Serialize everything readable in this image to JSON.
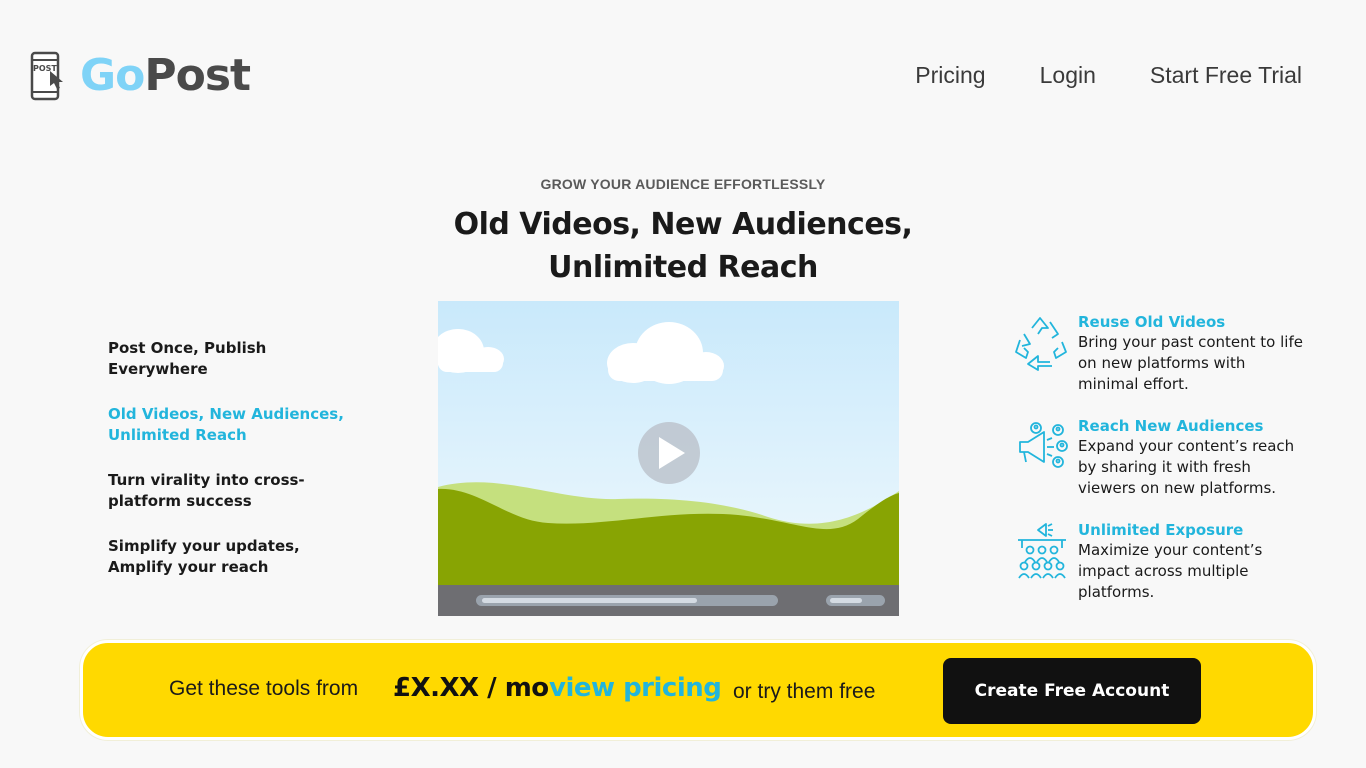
{
  "header": {
    "logo": {
      "go": "Go",
      "post": "Post",
      "icon_text": "POST",
      "icon": "phone-cursor-icon"
    },
    "nav": [
      {
        "label": "Pricing"
      },
      {
        "label": "Login"
      },
      {
        "label": "Start Free Trial"
      }
    ]
  },
  "hero": {
    "eyebrow": "GROW YOUR AUDIENCE EFFORTLESSLY",
    "title_line1": "Old Videos, New Audiences,",
    "title_line2": "Unlimited Reach"
  },
  "left_features": [
    {
      "line1": "Post Once, Publish",
      "line2": "Everywhere",
      "active": false
    },
    {
      "line1": "Old Videos, New Audiences,",
      "line2": "Unlimited Reach",
      "active": true
    },
    {
      "line1": "Turn virality into cross-",
      "line2": "platform success",
      "active": false
    },
    {
      "line1": "Simplify your updates,",
      "line2": "Amplify your reach",
      "active": false
    }
  ],
  "video": {
    "icon": "play-icon",
    "progress": 0.74
  },
  "right_features": [
    {
      "title": "Reuse Old Videos",
      "desc": [
        "Bring your past content to life",
        "on new platforms with",
        "minimal effort."
      ],
      "icon": "recycle-icon"
    },
    {
      "title": "Reach New Audiences",
      "desc": [
        "Expand your content’s reach",
        "by sharing it with fresh",
        "viewers on new platforms."
      ],
      "icon": "megaphone-icon"
    },
    {
      "title": "Unlimited Exposure",
      "desc": [
        "Maximize your content’s",
        "impact across multiple",
        "platforms."
      ],
      "icon": "crowd-icon"
    }
  ],
  "cta": {
    "text1": "Get these tools from",
    "price": "£X.XX / mo",
    "link": "view pricing",
    "text2": "or try them free",
    "button": "Create Free Account"
  },
  "colors": {
    "accent": "#22b5dc",
    "cta_bg": "#ffd900",
    "button": "#111111",
    "logo_go": "#7fd3f7"
  }
}
